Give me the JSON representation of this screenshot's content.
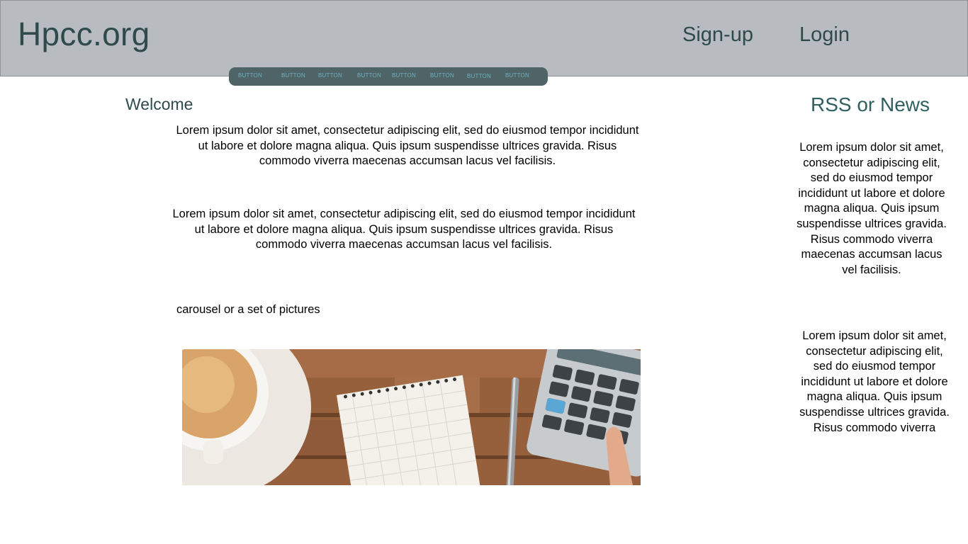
{
  "header": {
    "brand": "Hpcc.org",
    "signup": "Sign-up",
    "login": "Login"
  },
  "toolbar": {
    "buttons": [
      "BUTTON",
      "BUTTON",
      "BUTTON",
      "BUTTON",
      "BUTTON",
      "BUTTON",
      "BUTTON",
      "BUTTON"
    ]
  },
  "main": {
    "welcome": "Welcome",
    "paragraph1": "Lorem ipsum dolor sit amet, consectetur adipiscing elit, sed do eiusmod tempor incididunt ut labore et dolore magna aliqua. Quis ipsum suspendisse ultrices gravida. Risus commodo viverra maecenas accumsan lacus vel facilisis.",
    "paragraph2": "Lorem ipsum dolor sit amet, consectetur adipiscing elit, sed do eiusmod tempor incididunt ut labore et dolore magna aliqua. Quis ipsum suspendisse ultrices gravida. Risus commodo viverra maecenas accumsan lacus vel facilisis.",
    "carousel_label": "carousel or a set of pictures"
  },
  "sidebar": {
    "title": "RSS or News",
    "item1": "Lorem ipsum dolor sit amet, consectetur adipiscing elit, sed do eiusmod tempor incididunt ut labore et dolore magna aliqua. Quis ipsum suspendisse ultrices gravida. Risus commodo viverra maecenas accumsan lacus vel facilisis.",
    "item2": "Lorem ipsum dolor sit amet, consectetur adipiscing elit, sed do eiusmod tempor incididunt ut labore et dolore magna aliqua. Quis ipsum suspendisse ultrices gravida. Risus commodo viverra"
  },
  "colors": {
    "header_bg": "#b8bcc0",
    "brand_text": "#2f4a4a",
    "strip_bg": "#4f6466",
    "strip_text": "#6fb1bf",
    "rss_title": "#2f5f5f"
  }
}
